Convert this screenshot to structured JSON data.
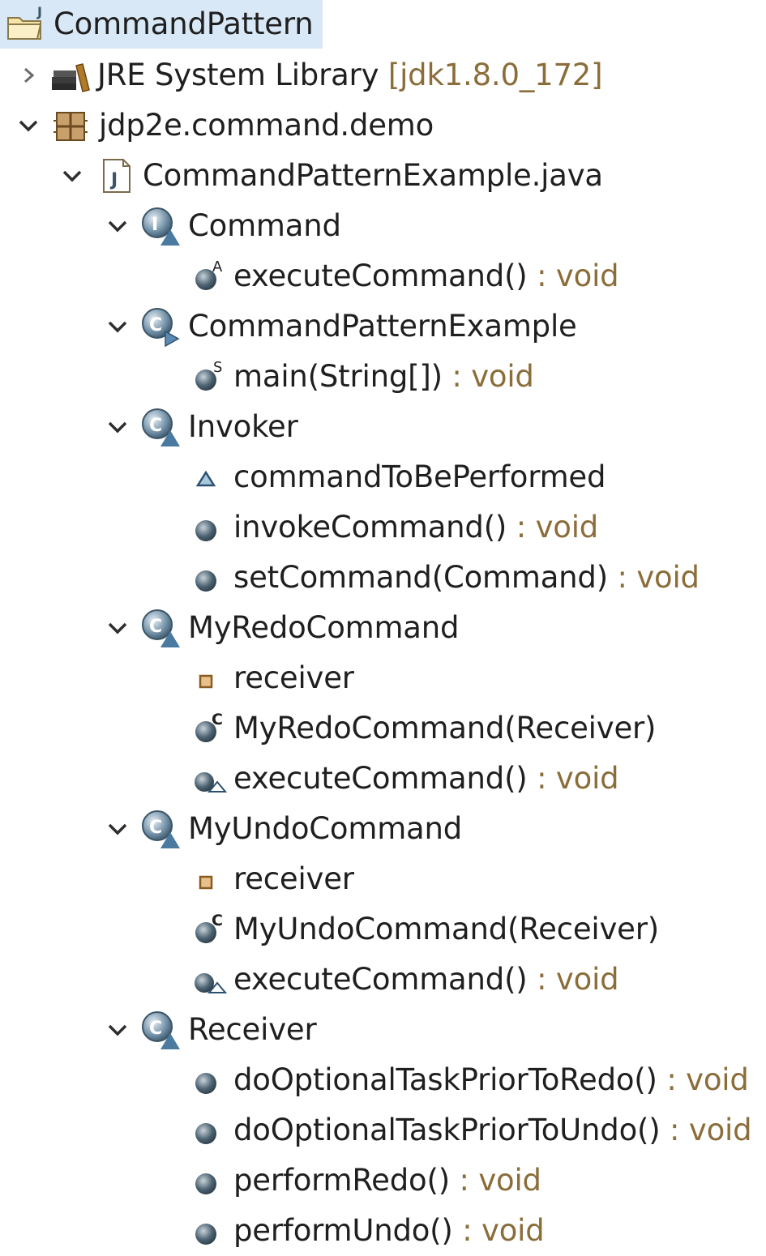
{
  "project": {
    "name": "CommandPattern"
  },
  "library": {
    "name": "JRE System Library",
    "decoration": "[jdk1.8.0_172]"
  },
  "package": {
    "name": "jdp2e.command.demo"
  },
  "file": {
    "name": "CommandPatternExample.java"
  },
  "types": {
    "command": {
      "name": "Command",
      "members": [
        {
          "name": "executeCommand()",
          "type": " : void"
        }
      ]
    },
    "example": {
      "name": "CommandPatternExample",
      "members": [
        {
          "name": "main(String[])",
          "type": " : void"
        }
      ]
    },
    "invoker": {
      "name": "Invoker",
      "members": [
        {
          "name": "commandToBePerformed",
          "type": ""
        },
        {
          "name": "invokeCommand()",
          "type": " : void"
        },
        {
          "name": "setCommand(Command)",
          "type": " : void"
        }
      ]
    },
    "redo": {
      "name": "MyRedoCommand",
      "members": [
        {
          "name": "receiver",
          "type": ""
        },
        {
          "name": "MyRedoCommand(Receiver)",
          "type": ""
        },
        {
          "name": "executeCommand()",
          "type": " : void"
        }
      ]
    },
    "undo": {
      "name": "MyUndoCommand",
      "members": [
        {
          "name": "receiver",
          "type": ""
        },
        {
          "name": "MyUndoCommand(Receiver)",
          "type": ""
        },
        {
          "name": "executeCommand()",
          "type": " : void"
        }
      ]
    },
    "receiver": {
      "name": "Receiver",
      "members": [
        {
          "name": "doOptionalTaskPriorToRedo()",
          "type": " : void"
        },
        {
          "name": "doOptionalTaskPriorToUndo()",
          "type": " : void"
        },
        {
          "name": "performRedo()",
          "type": " : void"
        },
        {
          "name": "performUndo()",
          "type": " : void"
        }
      ]
    }
  },
  "colors": {
    "selection": "#d9e8f6",
    "type_decoration": "#8b6d3a",
    "method_public": "#3c5a6e",
    "class_icon": "#3b6b8c"
  }
}
